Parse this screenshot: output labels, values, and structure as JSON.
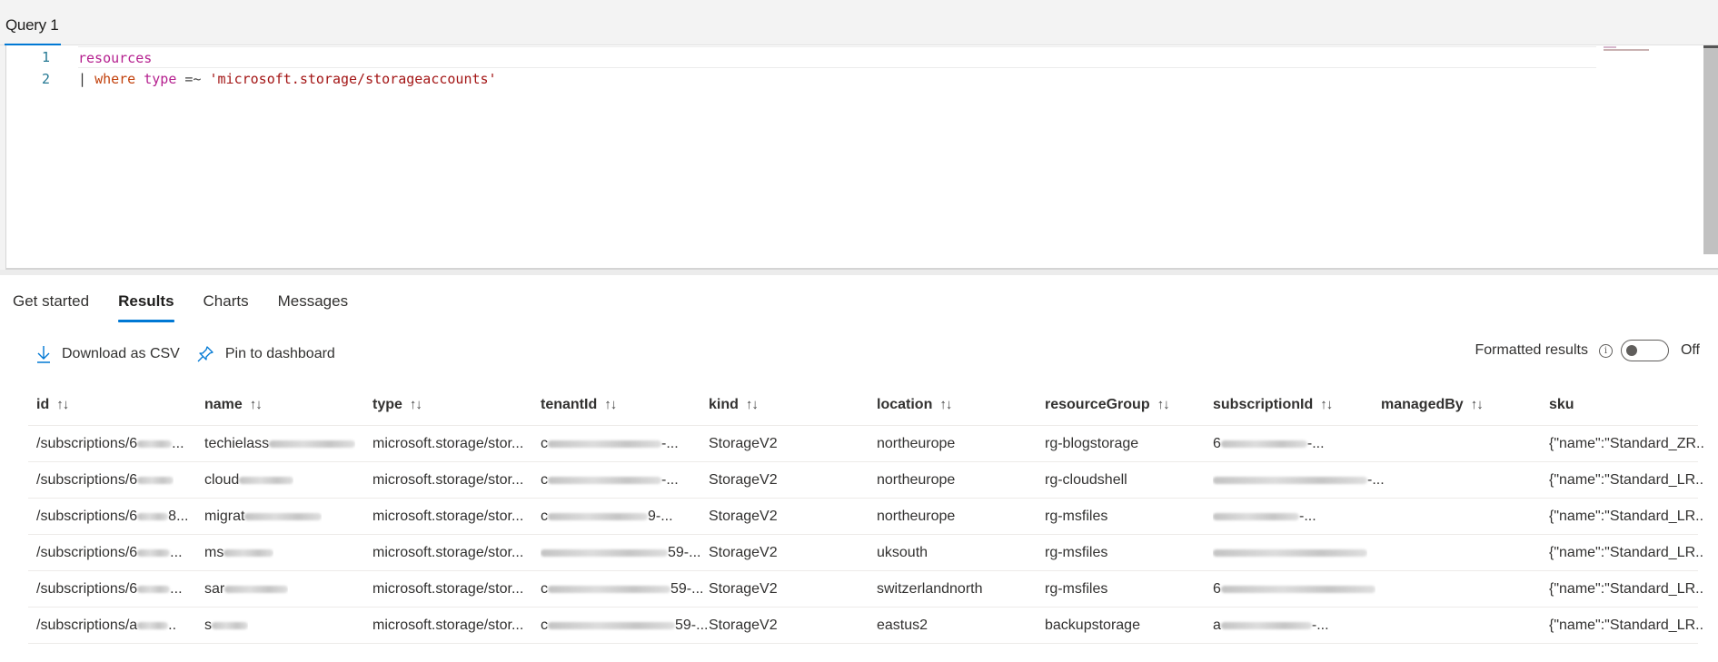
{
  "query_tab": {
    "label": "Query 1"
  },
  "editor": {
    "lines": [
      {
        "number": "1",
        "tokens": {
          "table": "resources"
        }
      },
      {
        "number": "2",
        "tokens": {
          "pipe": "|",
          "operator": "where",
          "field": "type",
          "eq": "=~",
          "string": "'microsoft.storage/storageaccounts'"
        }
      }
    ]
  },
  "results_tabs": [
    {
      "label": "Get started",
      "active": false
    },
    {
      "label": "Results",
      "active": true
    },
    {
      "label": "Charts",
      "active": false
    },
    {
      "label": "Messages",
      "active": false
    }
  ],
  "toolbar": {
    "download_label": "Download as CSV",
    "pin_label": "Pin to dashboard",
    "formatted_label": "Formatted results",
    "toggle_state": "Off",
    "info_glyph": "i"
  },
  "colors": {
    "accent": "#0078d4"
  },
  "table": {
    "sort_glyph": "↑↓",
    "columns": [
      "id",
      "name",
      "type",
      "tenantId",
      "kind",
      "location",
      "resourceGroup",
      "subscriptionId",
      "managedBy",
      "sku"
    ],
    "rows": [
      {
        "id": "/subscriptions/6",
        "id_suffix": "...",
        "name": "techielass",
        "type": "microsoft.storage/stor...",
        "tenantId": "c",
        "tenantId_suffix": "-...",
        "kind": "StorageV2",
        "location": "northeurope",
        "resourceGroup": "rg-blogstorage",
        "subscriptionId": "6",
        "subscriptionId_suffix": "-...",
        "managedBy": "",
        "sku": "{\"name\":\"Standard_ZR.."
      },
      {
        "id": "/subscriptions/6",
        "id_suffix": "",
        "name": "cloud",
        "type": "microsoft.storage/stor...",
        "tenantId": "c",
        "tenantId_suffix": "-...",
        "kind": "StorageV2",
        "location": "northeurope",
        "resourceGroup": "rg-cloudshell",
        "subscriptionId": "",
        "subscriptionId_suffix": "-...",
        "managedBy": "",
        "sku": "{\"name\":\"Standard_LR.."
      },
      {
        "id": "/subscriptions/6",
        "id_suffix": "8...",
        "name": "migrat",
        "type": "microsoft.storage/stor...",
        "tenantId": "c",
        "tenantId_suffix": "9-...",
        "kind": "StorageV2",
        "location": "northeurope",
        "resourceGroup": "rg-msfiles",
        "subscriptionId": "",
        "subscriptionId_suffix": "-...",
        "managedBy": "",
        "sku": "{\"name\":\"Standard_LR.."
      },
      {
        "id": "/subscriptions/6",
        "id_suffix": "...",
        "name": "ms",
        "type": "microsoft.storage/stor...",
        "tenantId": "",
        "tenantId_suffix": "59-...",
        "kind": "StorageV2",
        "location": "uksouth",
        "resourceGroup": "rg-msfiles",
        "subscriptionId": "",
        "subscriptionId_suffix": "",
        "managedBy": "",
        "sku": "{\"name\":\"Standard_LR.."
      },
      {
        "id": "/subscriptions/6",
        "id_suffix": "...",
        "name": "sar",
        "type": "microsoft.storage/stor...",
        "tenantId": "c",
        "tenantId_suffix": "59-...",
        "kind": "StorageV2",
        "location": "switzerlandnorth",
        "resourceGroup": "rg-msfiles",
        "subscriptionId": "6",
        "subscriptionId_suffix": "",
        "managedBy": "",
        "sku": "{\"name\":\"Standard_LR.."
      },
      {
        "id": "/subscriptions/a",
        "id_suffix": "..",
        "name": "s",
        "type": "microsoft.storage/stor...",
        "tenantId": "c",
        "tenantId_suffix": "59-...",
        "kind": "StorageV2",
        "location": "eastus2",
        "resourceGroup": "backupstorage",
        "subscriptionId": "a",
        "subscriptionId_suffix": "-...",
        "managedBy": "",
        "sku": "{\"name\":\"Standard_LR.."
      }
    ]
  }
}
